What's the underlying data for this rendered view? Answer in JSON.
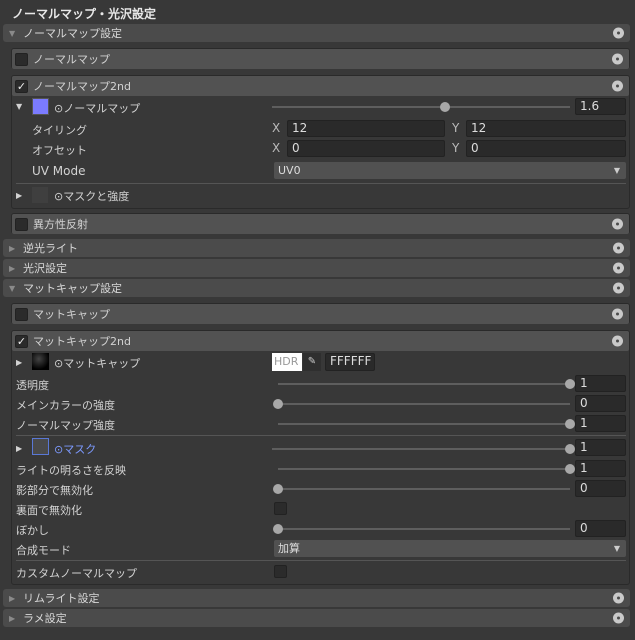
{
  "title": "ノーマルマップ・光沢設定",
  "sections": {
    "normal_settings": "ノーマルマップ設定",
    "backlight": "逆光ライト",
    "gloss": "光沢設定",
    "matcap_settings": "マットキャップ設定",
    "rimlight": "リムライト設定",
    "glitter": "ラメ設定"
  },
  "normal_map": {
    "label": "ノーマルマップ",
    "checked": false
  },
  "normal_map_2nd": {
    "label": "ノーマルマップ2nd",
    "checked": true,
    "texture_label": "⊙ノーマルマップ",
    "texture_color": "#7b7bff",
    "strength": "1.6",
    "strength_slider": 0.58,
    "tiling_label": "タイリング",
    "tiling_x": "12",
    "tiling_y": "12",
    "offset_label": "オフセット",
    "offset_x": "0",
    "offset_y": "0",
    "x": "X",
    "y": "Y",
    "uv_mode_label": "UV Mode",
    "uv_mode": "UV0",
    "mask_label": "⊙マスクと強度"
  },
  "anisotropy": {
    "label": "異方性反射",
    "checked": false
  },
  "matcap": {
    "label": "マットキャップ",
    "checked": false
  },
  "matcap_2nd": {
    "label": "マットキャップ2nd",
    "checked": true,
    "texture_label": "⊙マットキャップ",
    "hdr": "HDR",
    "color_hex": "FFFFFF",
    "rows": [
      {
        "label": "透明度",
        "value": "1",
        "slider": 1
      },
      {
        "label": "メインカラーの強度",
        "value": "0",
        "slider": 0
      },
      {
        "label": "ノーマルマップ強度",
        "value": "1",
        "slider": 1
      }
    ],
    "mask_label": "⊙マスク",
    "mask_value": "1",
    "mask_slider": 1,
    "rows2": [
      {
        "label": "ライトの明るさを反映",
        "value": "1",
        "slider": 1
      },
      {
        "label": "影部分で無効化",
        "value": "0",
        "slider": 0
      }
    ],
    "backface_label": "裏面で無効化",
    "blur_label": "ぼかし",
    "blur_value": "0",
    "blur_slider": 0,
    "blend_label": "合成モード",
    "blend_mode": "加算",
    "custom_normal_label": "カスタムノーマルマップ"
  }
}
